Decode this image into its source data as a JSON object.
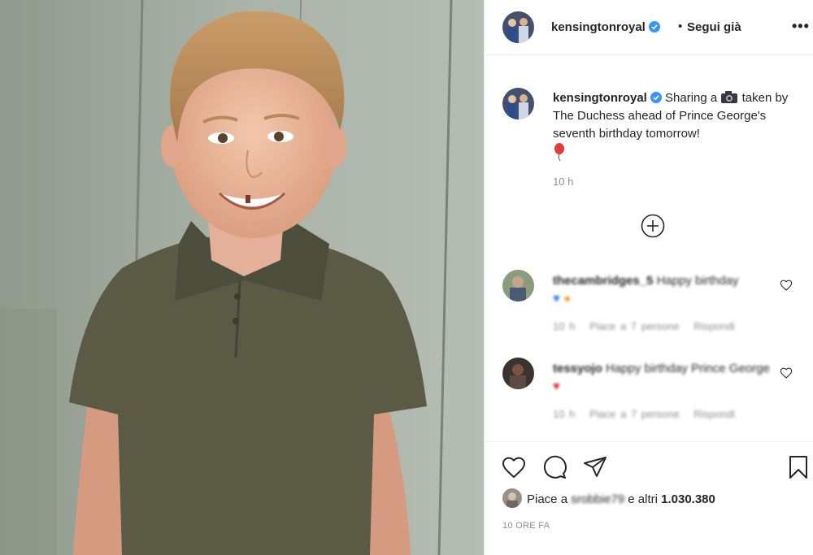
{
  "header": {
    "username": "kensingtonroyal",
    "separator": "•",
    "follow_label": "Segui già",
    "more_label": "•••"
  },
  "caption": {
    "username": "kensingtonroyal",
    "text_before_icon": "Sharing a",
    "text_after_icon": "taken by The Duchess ahead of Prince George's seventh birthday tomorrow!",
    "time": "10 h"
  },
  "comments": [
    {
      "username": "thecambridges_5",
      "text": "Happy birthday",
      "time": "10 h",
      "likes": "Piace a 7 persone",
      "reply": "Rispondi"
    },
    {
      "username": "tessyojo",
      "text": "Happy birthday Prince George",
      "time": "10 h",
      "likes": "Piace a 7 persone",
      "reply": "Rispondi"
    }
  ],
  "likes": {
    "prefix": "Piace a",
    "user": "srobbie79",
    "conjunction": "e altri",
    "count": "1.030.380"
  },
  "date": "10 ORE FA",
  "colors": {
    "verified": "#3897f0",
    "text": "#262626",
    "secondary": "#8e8e8e",
    "border": "#efefef"
  },
  "icons": [
    "verified-badge-icon",
    "camera-emoji-icon",
    "balloon-emoji-icon",
    "plus-circle-icon",
    "heart-icon",
    "comment-icon",
    "share-icon",
    "bookmark-icon"
  ]
}
